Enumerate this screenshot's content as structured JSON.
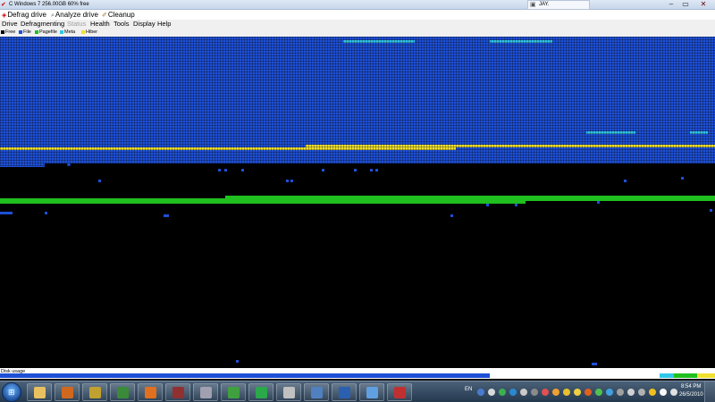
{
  "window": {
    "title": "C Windows 7  256.00GB 60% free",
    "other_window_title": "JAY.",
    "min_glyph": "–",
    "max_glyph": "▭",
    "close_glyph": "✕"
  },
  "toolbar": {
    "defrag_label": "Defrag drive",
    "analyze_label": "Analyze drive",
    "cleanup_label": "Cleanup"
  },
  "menu": {
    "items": [
      "Drive",
      "Defragmenting",
      "Status",
      "Health",
      "Tools",
      "Display",
      "Help"
    ]
  },
  "legend": {
    "items": [
      {
        "label": "Free",
        "color": "#000000"
      },
      {
        "label": "File",
        "color": "#1e50d6"
      },
      {
        "label": "Pagefile",
        "color": "#20c020"
      },
      {
        "label": "Meta",
        "color": "#30c8e8"
      },
      {
        "label": "Hiber",
        "color": "#f0e030"
      }
    ]
  },
  "diskmap": {
    "colors": {
      "file": "#1e50d6",
      "hiber": "#f0e030",
      "page": "#20c020",
      "meta": "#30c8e8",
      "free": "#000000"
    }
  },
  "usage": {
    "label": "Disk usage"
  },
  "taskbar": {
    "apps": [
      "explorer-icon",
      "media-player-icon",
      "tool-icon",
      "app-icon",
      "firefox-icon",
      "app2-icon",
      "shield-app-icon",
      "network-app-icon",
      "utorrent-icon",
      "media-app-icon",
      "remote-icon",
      "word-icon",
      "paint-icon",
      "defrag-app-icon"
    ],
    "app_colors": [
      "#e8c060",
      "#d06820",
      "#c0a030",
      "#3a8a3a",
      "#e07020",
      "#903030",
      "#a0a0b0",
      "#40a040",
      "#2aa84a",
      "#c0c0c0",
      "#5080c0",
      "#2b5fb0",
      "#60a0e0",
      "#c03030"
    ]
  },
  "tray": {
    "lang": "EN",
    "time": "8:54 PM",
    "date": "26/5/2010"
  }
}
